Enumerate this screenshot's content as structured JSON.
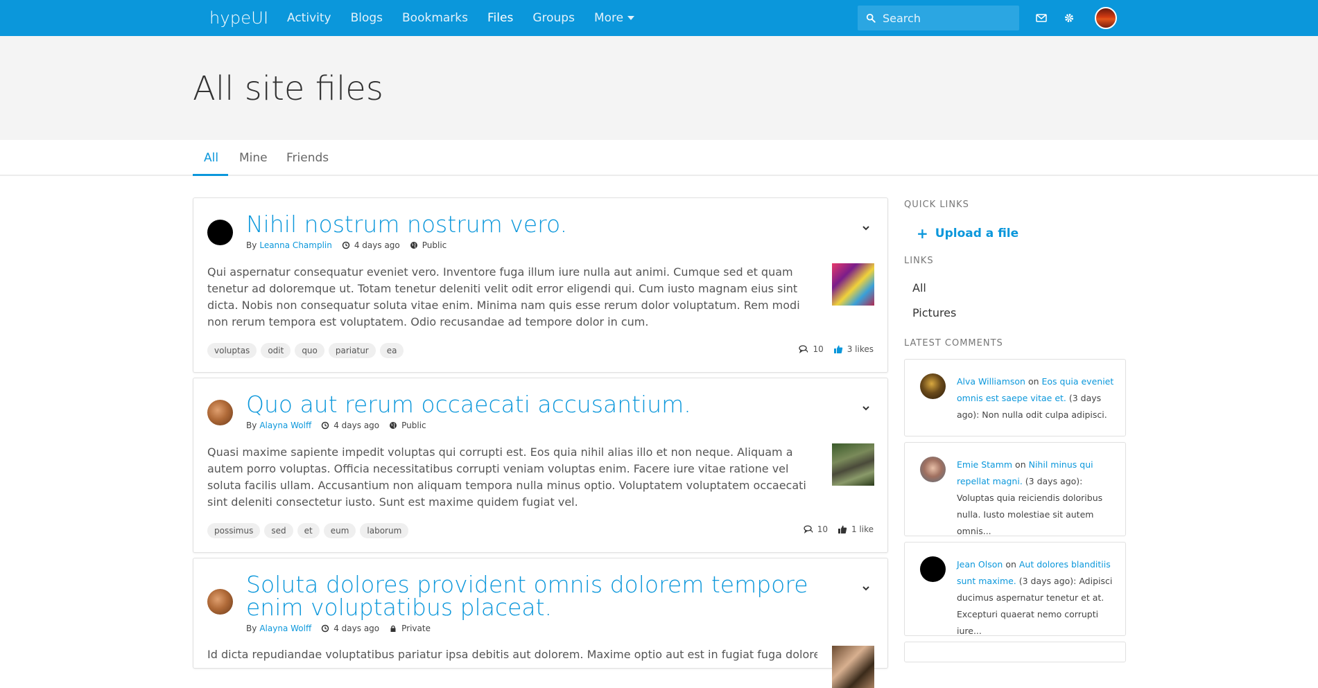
{
  "nav": {
    "brand": "hypeUI",
    "items": [
      {
        "label": "Activity"
      },
      {
        "label": "Blogs"
      },
      {
        "label": "Bookmarks"
      },
      {
        "label": "Files"
      },
      {
        "label": "Groups"
      },
      {
        "label": "More"
      }
    ],
    "search_placeholder": "Search"
  },
  "page": {
    "title": "All site files"
  },
  "tabs": [
    {
      "label": "All"
    },
    {
      "label": "Mine"
    },
    {
      "label": "Friends"
    }
  ],
  "files": [
    {
      "title": "Nihil nostrum nostrum vero.",
      "by": "By",
      "author": "Leanna Champlin",
      "time": "4 days ago",
      "access": "Public",
      "body": "Qui aspernatur consequatur eveniet vero. Inventore fuga illum iure nulla aut animi. Cumque sed et quam tenetur ad doloremque ut. Totam tenetur deleniti velit odit error eligendi qui. Cum iusto magnam eius sint dicta. Nobis non consequatur soluta vitae enim. Minima nam quis esse rerum dolor voluptatum. Rem modi non rerum tempora est voluptatem. Odio recusandae ad tempore dolor in cum.",
      "tags": [
        "voluptas",
        "odit",
        "quo",
        "pariatur",
        "ea"
      ],
      "comments": "10",
      "likes": "3 likes"
    },
    {
      "title": "Quo aut rerum occaecati accusantium.",
      "by": "By",
      "author": "Alayna Wolff",
      "time": "4 days ago",
      "access": "Public",
      "body": "Quasi maxime sapiente impedit voluptas qui corrupti est. Eos quia nihil alias illo et non neque. Aliquam a autem porro voluptas. Officia necessitatibus corrupti veniam voluptas enim. Facere iure vitae ratione vel soluta facilis ullam. Accusantium non aliquam tempora nulla minus optio. Voluptatem voluptatem occaecati sint deleniti consectetur iusto. Sunt est maxime quidem fugiat vel.",
      "tags": [
        "possimus",
        "sed",
        "et",
        "eum",
        "laborum"
      ],
      "comments": "10",
      "likes": "1 like"
    },
    {
      "title": "Soluta dolores provident omnis dolorem tempore enim voluptatibus placeat.",
      "by": "By",
      "author": "Alayna Wolff",
      "time": "4 days ago",
      "access": "Private",
      "body": "Id dicta repudiandae voluptatibus pariatur ipsa debitis aut dolorem. Maxime optio aut est in fugiat fuga doloremque"
    }
  ],
  "sidebar": {
    "quick_links_heading": "QUICK LINKS",
    "upload_label": "Upload a file",
    "links_heading": "LINKS",
    "links": [
      {
        "label": "All"
      },
      {
        "label": "Pictures"
      }
    ],
    "latest_comments_heading": "LATEST COMMENTS",
    "comments": [
      {
        "author": "Alva Williamson",
        "on": "on",
        "target": "Eos quia eveniet omnis est saepe vitae et.",
        "rest": " (3 days ago): Non nulla odit culpa adipisci."
      },
      {
        "author": "Emie Stamm",
        "on": "on",
        "target": "Nihil minus qui repellat magni.",
        "rest": " (3 days ago): Voluptas quia reiciendis doloribus nulla. Iusto molestiae sit autem omnis..."
      },
      {
        "author": "Jean Olson",
        "on": "on",
        "target": "Aut dolores blanditiis sunt maxime.",
        "rest": " (3 days ago): Adipisci ducimus aspernatur tenetur et at. Excepturi quaerat nemo corrupti iure..."
      }
    ]
  },
  "colors": {
    "accent": "#0b97db",
    "page_head_bg": "#f4f4f4"
  }
}
